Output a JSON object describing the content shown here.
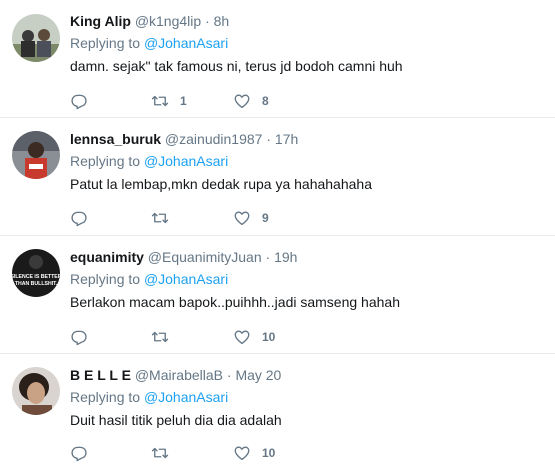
{
  "tweets": [
    {
      "name": "King Alip",
      "handle": "@k1ng4lip",
      "time": "8h",
      "replying_label": "Replying to",
      "replying_to": "@JohanAsari",
      "text": "damn. sejak\" tak famous ni, terus jd bodoh camni huh",
      "retweets": "1",
      "likes": "8"
    },
    {
      "name": "lennsa_buruk",
      "handle": "@zainudin1987",
      "time": "17h",
      "replying_label": "Replying to",
      "replying_to": "@JohanAsari",
      "text": "Patut la lembap,mkn dedak rupa ya hahahahaha",
      "retweets": "",
      "likes": "9"
    },
    {
      "name": "equanimity",
      "handle": "@EquanimityJuan",
      "time": "19h",
      "replying_label": "Replying to",
      "replying_to": "@JohanAsari",
      "text": "Berlakon macam bapok..puihhh..jadi samseng hahah",
      "retweets": "",
      "likes": "10",
      "avatar_text": "SILENCE IS BETTER THAN BULLSHIT"
    },
    {
      "name": "B E L L E",
      "handle": "@MairabellaB",
      "time": "May 20",
      "replying_label": "Replying to",
      "replying_to": "@JohanAsari",
      "text": "Duit hasil titik peluh dia dia adalah",
      "retweets": "",
      "likes": "10"
    }
  ],
  "separator": "·",
  "colors": {
    "link": "#1da1f2",
    "muted": "#657786",
    "text": "#14171a",
    "divider": "#e6ecf0"
  },
  "icons": {
    "reply": "reply-icon",
    "retweet": "retweet-icon",
    "like": "heart-icon"
  }
}
